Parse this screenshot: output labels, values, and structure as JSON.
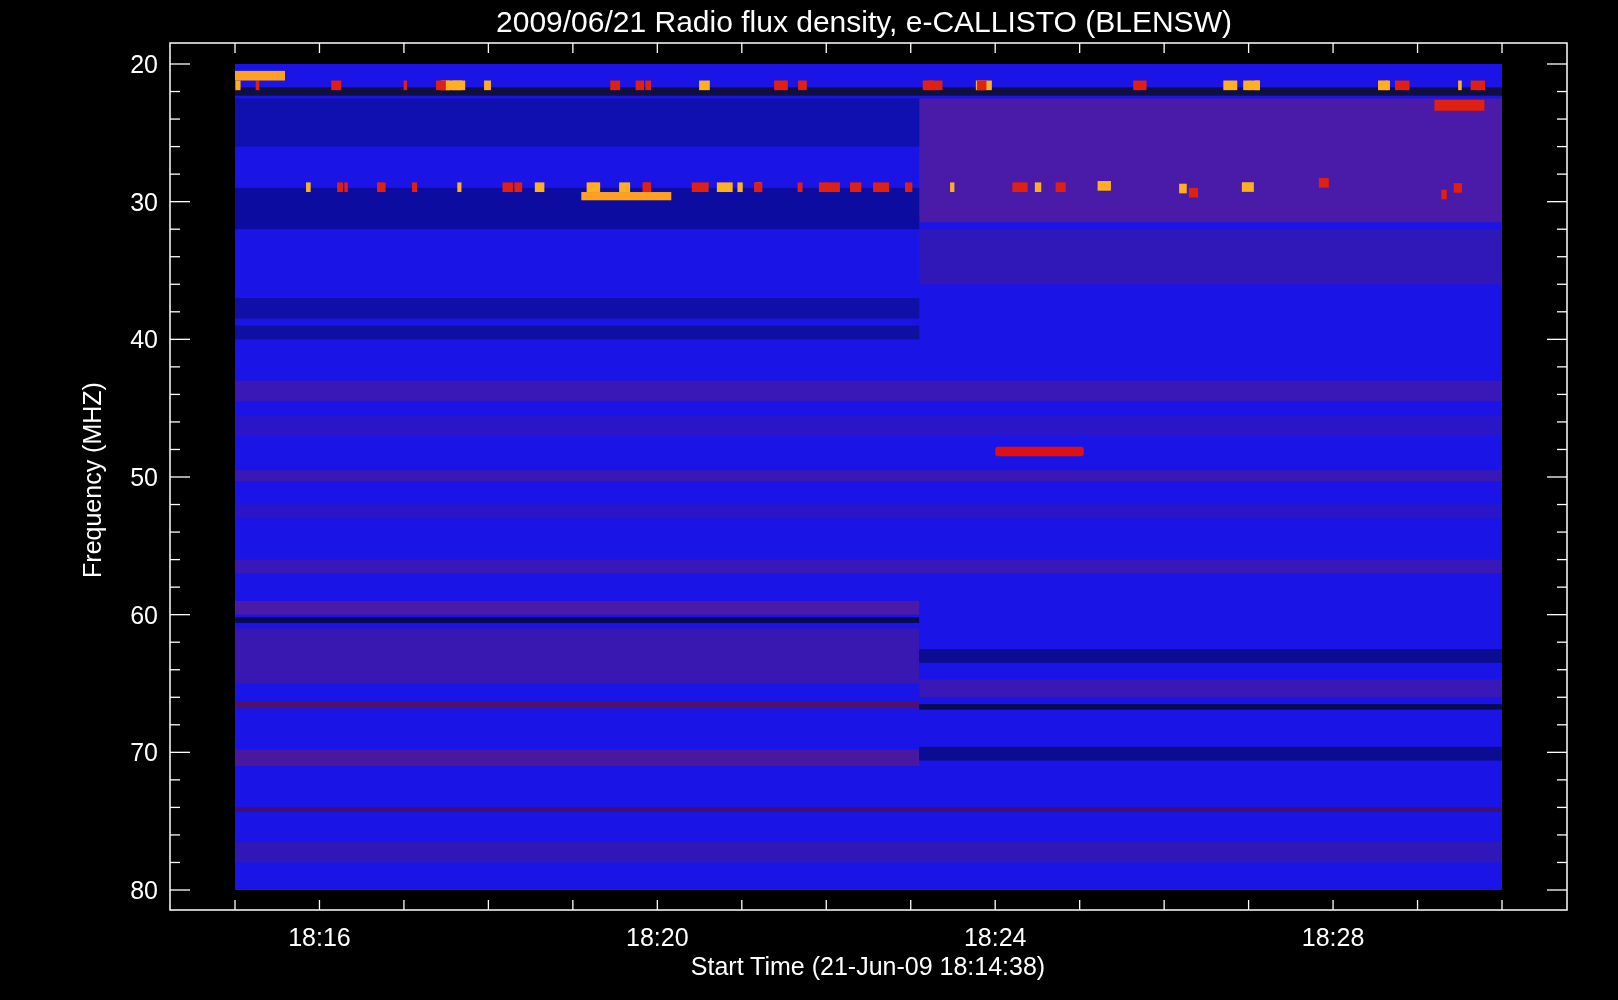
{
  "title": "2009/06/21  Radio flux density, e-CALLISTO (BLENSW)",
  "y_axis": {
    "label": "Frequency (MHZ)",
    "ticks": [
      "20",
      "30",
      "40",
      "50",
      "60",
      "70",
      "80"
    ]
  },
  "x_axis": {
    "label": "Start Time (21-Jun-09 18:14:38)",
    "ticks": [
      "18:16",
      "18:20",
      "18:24",
      "18:28"
    ]
  }
}
